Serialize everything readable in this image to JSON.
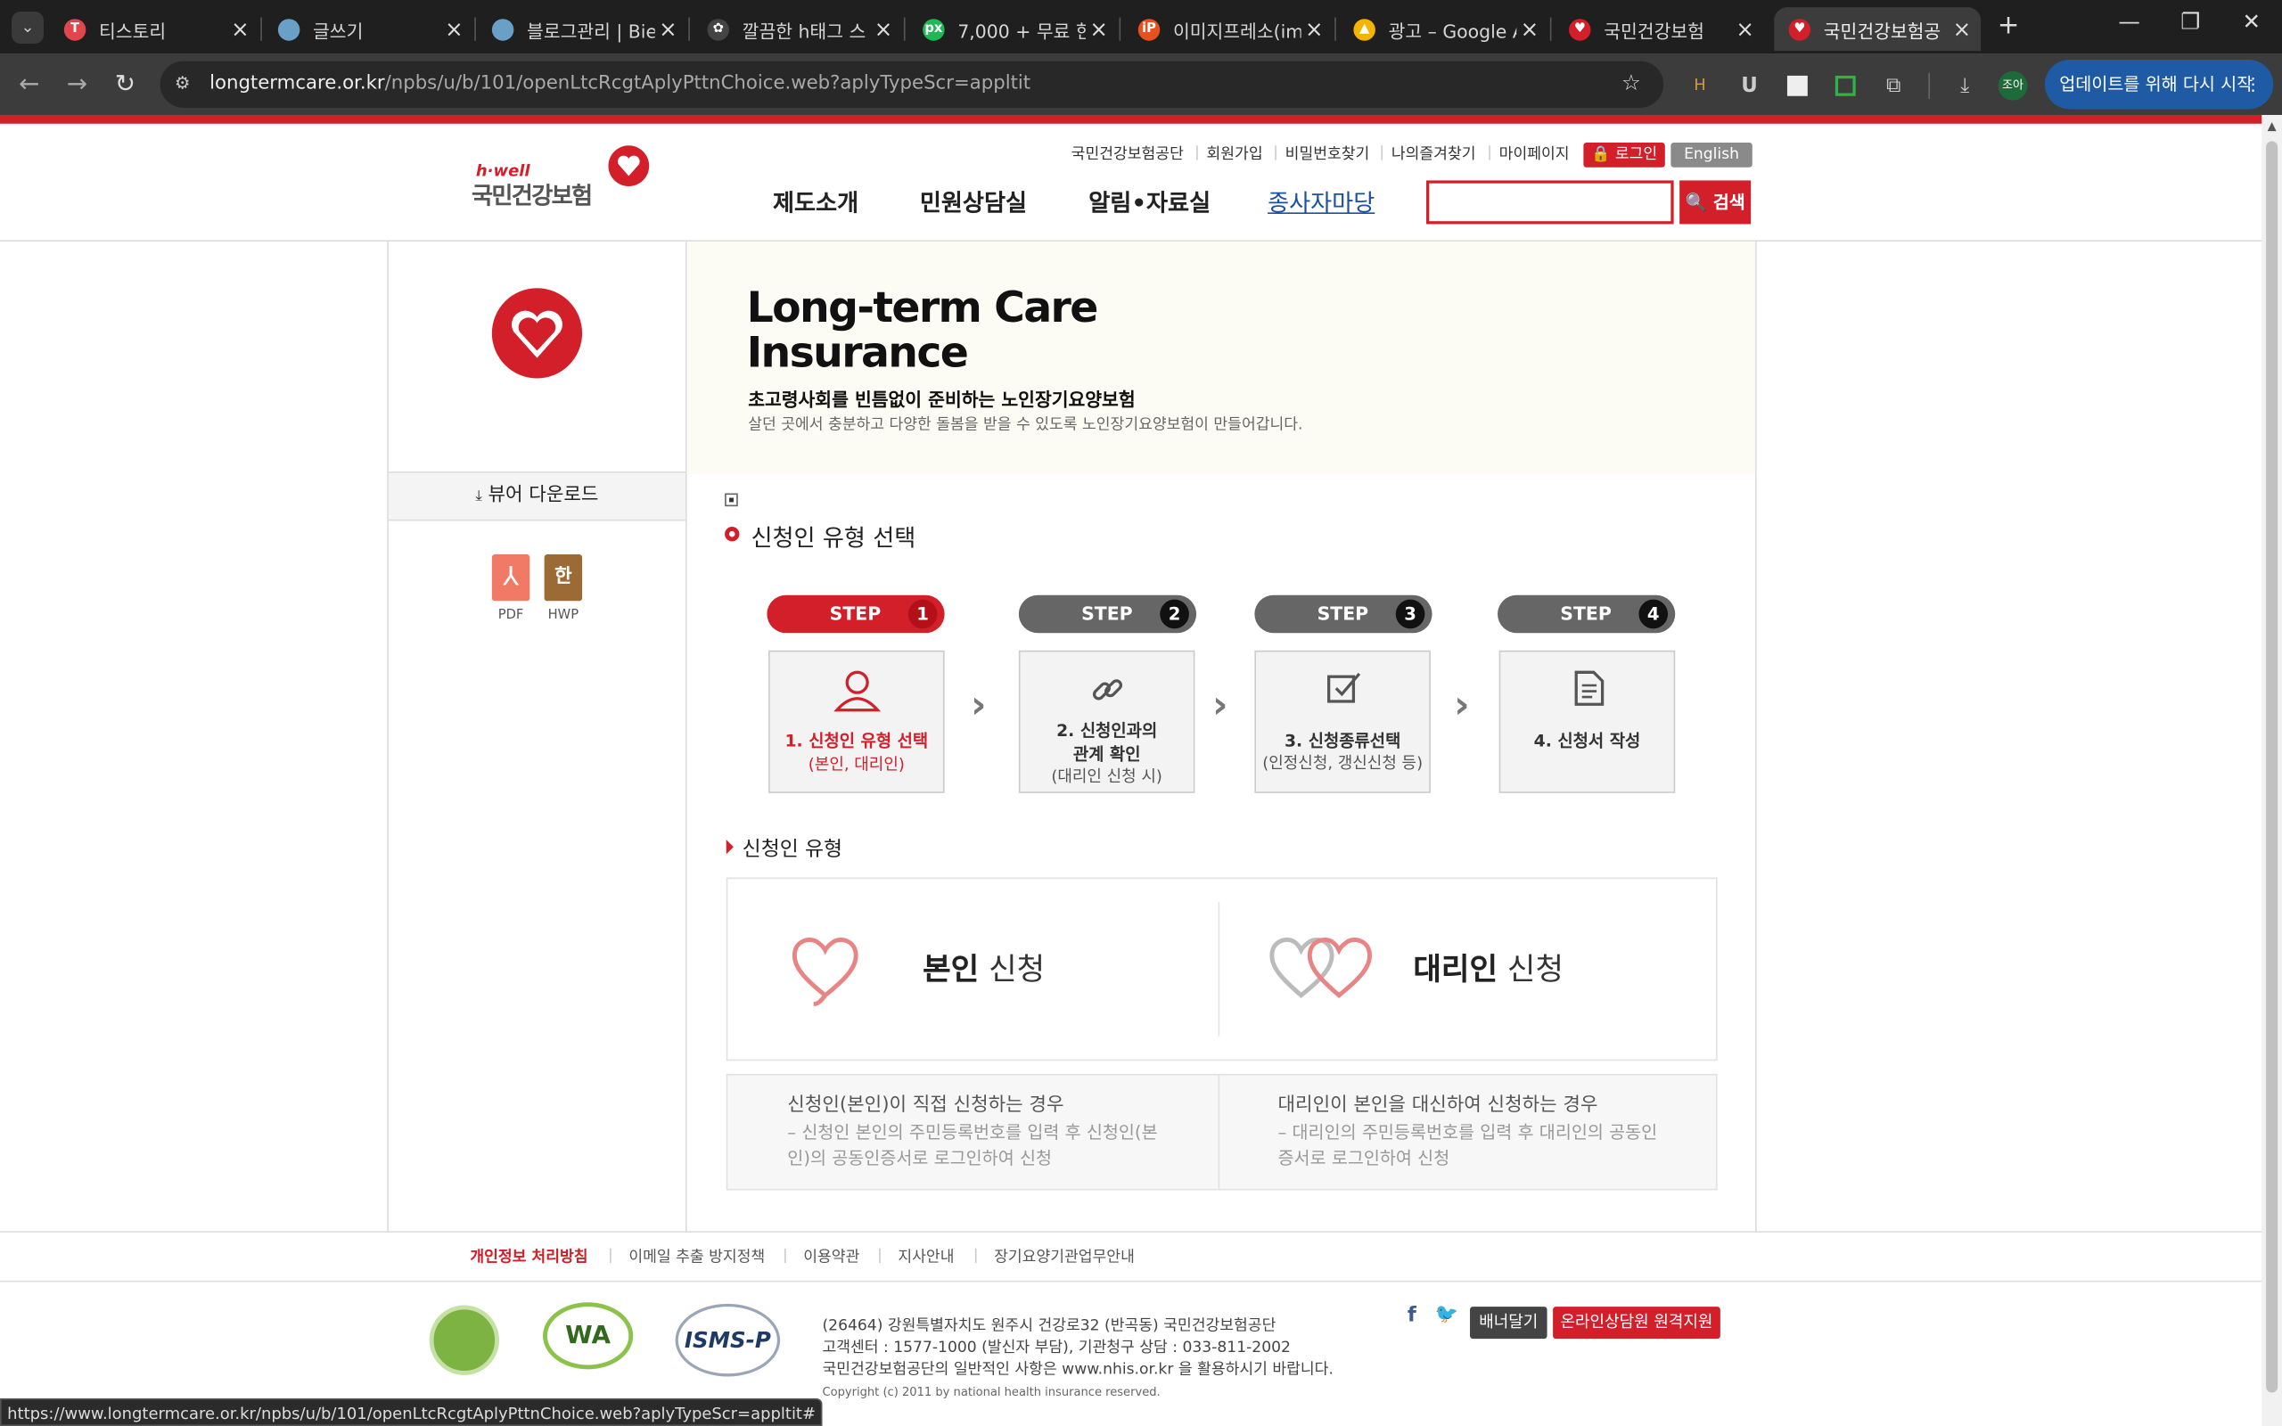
{
  "browser": {
    "tabs": [
      {
        "title": "티스토리",
        "color": "#e0474c",
        "glyph": "T"
      },
      {
        "title": "글쓰기",
        "color": "#6aa0c8",
        "glyph": ""
      },
      {
        "title": "블로그관리 | Bie",
        "color": "#6aa0c8",
        "glyph": ""
      },
      {
        "title": "깔끔한 h태그 스",
        "color": "#444444",
        "glyph": "✿"
      },
      {
        "title": "7,000 + 무료 한",
        "color": "#1db954",
        "glyph": "px"
      },
      {
        "title": "이미지프레소(im",
        "color": "#e8501e",
        "glyph": "iP"
      },
      {
        "title": "광고 – Google A",
        "color": "#f4b400",
        "glyph": "▲"
      },
      {
        "title": "국민건강보험",
        "color": "#d31f2a",
        "glyph": "♥"
      },
      {
        "title": "국민건강보험공",
        "color": "#d31f2a",
        "glyph": "♥"
      }
    ],
    "new_tab": "+",
    "url_domain": "longtermcare.or.kr",
    "url_path": "/npbs/u/b/101/openLtcRcgtAplyPttnChoice.web?aplyTypeScr=appltit",
    "profile": "조아",
    "update_button": "업데이트를 위해 다시 시작",
    "status_url": "https://www.longtermcare.or.kr/npbs/u/b/101/openLtcRcgtAplyPttnChoice.web?aplyTypeScr=appltit#"
  },
  "header": {
    "logo_sub": "h·well",
    "logo_main": "국민건강보험",
    "util": [
      "국민건강보험공단",
      "회원가입",
      "비밀번호찾기",
      "나의즐겨찾기",
      "마이페이지"
    ],
    "login": "로그인",
    "english": "English",
    "gnb": [
      "제도소개",
      "민원상담실",
      "알림•자료실",
      "종사자마당"
    ],
    "search_button": "검색",
    "search_value": ""
  },
  "sidebar": {
    "viewer_download": "뷰어 다운로드",
    "pdf_label": "PDF",
    "hwp_label": "HWP",
    "hwp_glyph": "한"
  },
  "banner": {
    "title1": "Long-term Care",
    "title2": "Insurance",
    "subtitle": "초고령사회를 빈틈없이 준비하는 노인장기요양보험",
    "desc": "살던 곳에서 충분하고 다양한 돌봄을 받을 수 있도록 노인장기요양보험이 만들어갑니다."
  },
  "content": {
    "title": "신청인 유형 선택",
    "steps": [
      {
        "pill": "STEP",
        "num": "1",
        "line1": "1. 신청인 유형 선택",
        "line2": "(본인, 대리인)",
        "line3": ""
      },
      {
        "pill": "STEP",
        "num": "2",
        "line1": "2. 신청인과의",
        "line2": "관계 확인",
        "line3": "(대리인 신청 시)"
      },
      {
        "pill": "STEP",
        "num": "3",
        "line1": "3. 신청종류선택",
        "line2": "(인정신청, 갱신신청 등)",
        "line3": ""
      },
      {
        "pill": "STEP",
        "num": "4",
        "line1": "4. 신청서 작성",
        "line2": "",
        "line3": ""
      }
    ],
    "section_title": "신청인 유형",
    "self": {
      "bold": "본인",
      "rest": " 신청",
      "desc_title": "신청인(본인)이 직접 신청하는 경우",
      "desc": "– 신청인 본인의 주민등록번호를 입력 후 신청인(본인)의 공동인증서로 로그인하여 신청"
    },
    "proxy": {
      "bold": "대리인",
      "rest": " 신청",
      "desc_title": "대리인이 본인을 대신하여 신청하는 경우",
      "desc": "– 대리인의 주민등록번호를 입력 후 대리인의 공동인증서로 로그인하여 신청"
    }
  },
  "footer": {
    "links": [
      "개인정보 처리방침",
      "이메일 추출 방지정책",
      "이용약관",
      "지사안내",
      "장기요양기관업무안내"
    ],
    "address": "(26464) 강원특별자치도 원주시 건강로32 (반곡동) 국민건강보험공단",
    "phone": "고객센터 : 1577-1000 (발신자 부담), 기관청구 상담 : 033-811-2002",
    "general": "국민건강보험공단의 일반적인 사항은 www.nhis.or.kr 을 활용하시기 바랍니다.",
    "copyright": "Copyright (c) 2011 by national health insurance reserved.",
    "banner_btn": "배너달기",
    "online_btn": "온라인상담원 원격지원",
    "cert1": "WA",
    "cert2": "ISMS-P"
  },
  "colors": {
    "brand_red": "#d31f2a",
    "step_active": "#d31f2a",
    "step_inactive": "#666666"
  }
}
